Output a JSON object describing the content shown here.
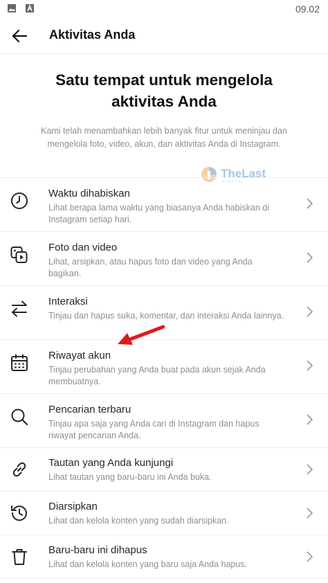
{
  "status_bar": {
    "time": "09.02"
  },
  "header": {
    "title": "Aktivitas Anda"
  },
  "hero": {
    "title": "Satu tempat untuk mengelola aktivitas Anda",
    "description": "Kami telah menambahkan lebih banyak fitur untuk meninjau dan mengelola foto, video, akun, dan aktivitas Anda di Instagram."
  },
  "watermark": {
    "text": "TheLast",
    "sub": "DIGITAL"
  },
  "menu": {
    "items": [
      {
        "label": "Waktu dihabiskan",
        "desc": "Lihat berapa lama waktu yang biasanya Anda habiskan di Instagram setiap hari.",
        "icon": "clock-icon"
      },
      {
        "label": "Foto dan video",
        "desc": "Lihat, arsipkan, atau hapus foto dan video yang Anda bagikan.",
        "icon": "photo-video-icon"
      },
      {
        "label": "Interaksi",
        "desc": "Tinjau dan hapus suka, komentar, dan interaksi Anda lainnya.",
        "icon": "arrows-exchange-icon"
      },
      {
        "label": "Riwayat akun",
        "desc": "Tinjau perubahan yang Anda buat pada akun sejak Anda membuatnya.",
        "icon": "calendar-icon"
      },
      {
        "label": "Pencarian terbaru",
        "desc": "Tinjau apa saja yang Anda cari di Instagram dan hapus riwayat pencarian Anda.",
        "icon": "search-icon"
      },
      {
        "label": "Tautan yang Anda kunjungi",
        "desc": "Lihat tautan yang baru-baru ini Anda buka.",
        "icon": "link-icon"
      },
      {
        "label": "Diarsipkan",
        "desc": "Lihat dan kelola konten yang sudah diarsipkan.",
        "icon": "archive-history-icon"
      },
      {
        "label": "Baru-baru ini dihapus",
        "desc": "Lihat dan kelola konten yang baru saja Anda hapus.",
        "icon": "trash-icon"
      }
    ]
  },
  "colors": {
    "annotation_arrow": "#e0191f",
    "watermark": "#6aa3d6",
    "text_primary": "#262626",
    "text_secondary": "#8e8e8e"
  }
}
